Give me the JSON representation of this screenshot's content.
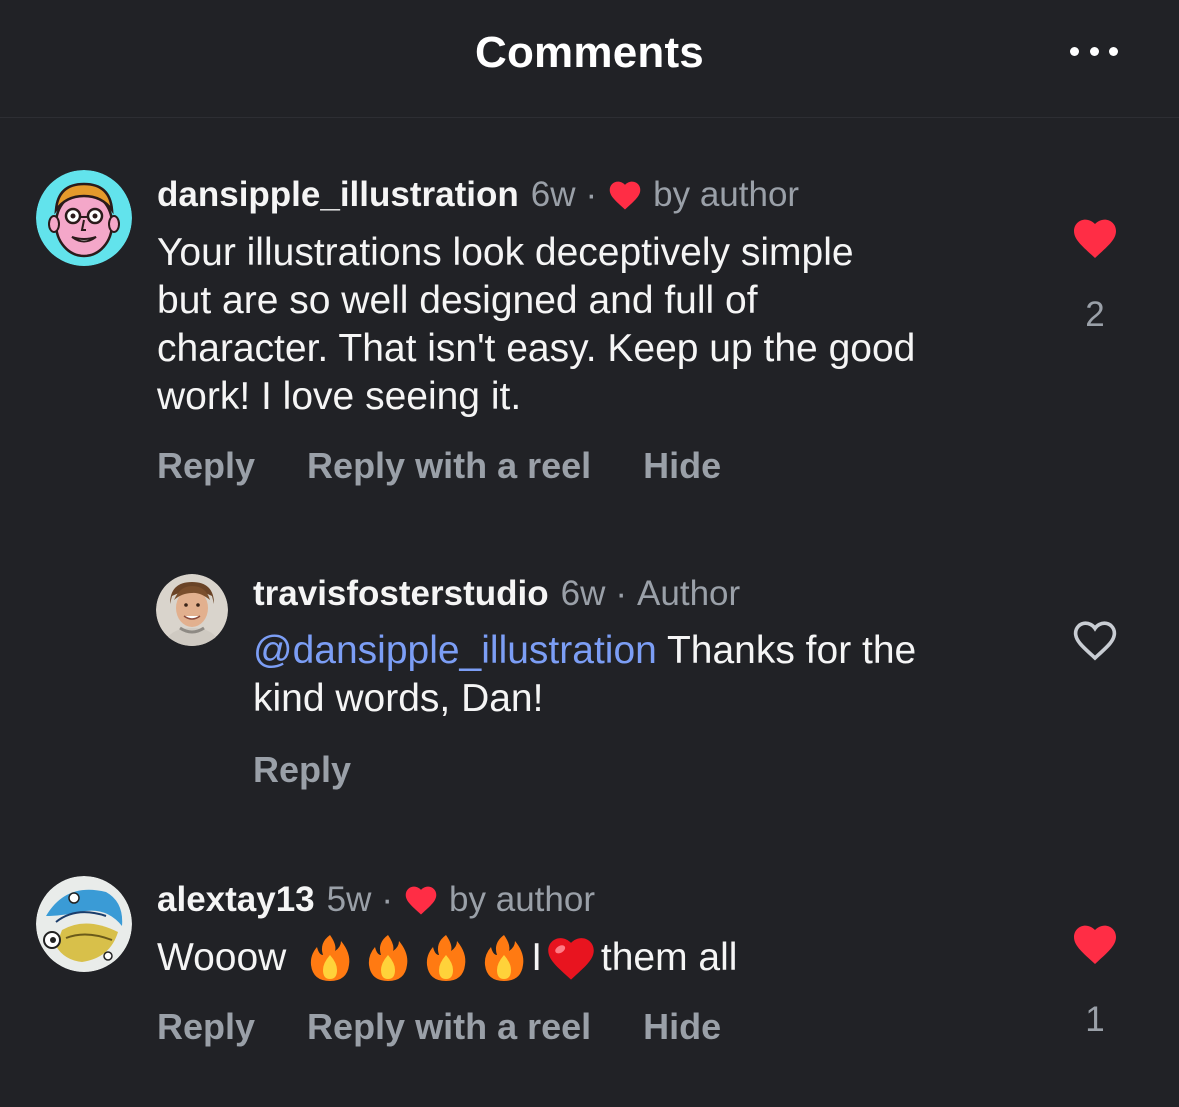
{
  "header": {
    "title": "Comments",
    "more_icon": "ellipsis-icon"
  },
  "colors": {
    "background": "#212226",
    "like_red": "#ff2d45",
    "mention_blue": "#7c9ef5",
    "muted_text": "#9aa0a8"
  },
  "comments": [
    {
      "username": "dansipple_illustration",
      "time": "6w",
      "separator": "·",
      "badge": "by author",
      "text": "Your illustrations look deceptively simple\nbut are so well designed and full of\ncharacter. That isn't easy. Keep up the good\nwork! I love seeing it.",
      "actions": [
        "Reply",
        "Reply with a reel",
        "Hide"
      ],
      "liked": true,
      "like_count": "2"
    },
    {
      "username": "travisfosterstudio",
      "time": "6w",
      "separator": "·",
      "badge": "Author",
      "mention": "@dansipple_illustration",
      "text": " Thanks for the\nkind words, Dan!",
      "actions": [
        "Reply"
      ],
      "liked": false
    },
    {
      "username": "alextay13",
      "time": "5w",
      "separator": "·",
      "badge": "by author",
      "text_start": "Wooow ",
      "text_mid": "I ",
      "text_end": "them all",
      "emojis": [
        "fire",
        "fire",
        "fire",
        "fire",
        "red-heart"
      ],
      "actions": [
        "Reply",
        "Reply with a reel",
        "Hide"
      ],
      "liked": true,
      "like_count": "1"
    }
  ]
}
